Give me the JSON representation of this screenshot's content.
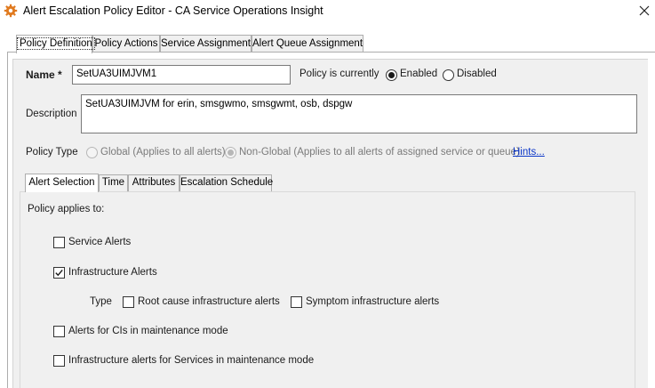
{
  "window": {
    "title": "Alert Escalation Policy Editor - CA Service Operations Insight",
    "icon": "gear-app-icon",
    "close_icon": "close-icon"
  },
  "outer_tabs": [
    {
      "label": "Policy Definition",
      "active": true
    },
    {
      "label": "Policy Actions",
      "active": false
    },
    {
      "label": "Service Assignment",
      "active": false
    },
    {
      "label": "Alert Queue Assignment",
      "active": false
    }
  ],
  "form": {
    "name_label": "Name *",
    "name_value": "SetUA3UIMJVM1",
    "status_label": "Policy is currently",
    "enabled_label": "Enabled",
    "disabled_label": "Disabled",
    "status_selected": "Enabled",
    "description_label": "Description",
    "description_value": "SetUA3UIMJVM for erin, smsgwmo, smsgwmt, osb, dspgw",
    "policy_type_label": "Policy Type",
    "global_label": "Global (Applies to all alerts)",
    "nonglobal_label": "Non-Global (Applies to all alerts of assigned service or queue)",
    "policy_type_selected": "Non-Global",
    "hints_link": "Hints..."
  },
  "inner_tabs": [
    {
      "label": "Alert Selection",
      "active": true
    },
    {
      "label": "Time",
      "active": false
    },
    {
      "label": "Attributes",
      "active": false
    },
    {
      "label": "Escalation Schedule",
      "active": false
    }
  ],
  "alert_selection": {
    "heading": "Policy applies to:",
    "service_alerts": {
      "label": "Service Alerts",
      "checked": false
    },
    "infrastructure_alerts": {
      "label": "Infrastructure Alerts",
      "checked": true
    },
    "type_label": "Type",
    "root_cause": {
      "label": "Root cause infrastructure alerts",
      "checked": false
    },
    "symptom": {
      "label": "Symptom infrastructure alerts",
      "checked": false
    },
    "maintenance_cis": {
      "label": "Alerts for CIs in maintenance mode",
      "checked": false
    },
    "maintenance_services": {
      "label": "Infrastructure alerts for Services in maintenance mode",
      "checked": false
    }
  }
}
